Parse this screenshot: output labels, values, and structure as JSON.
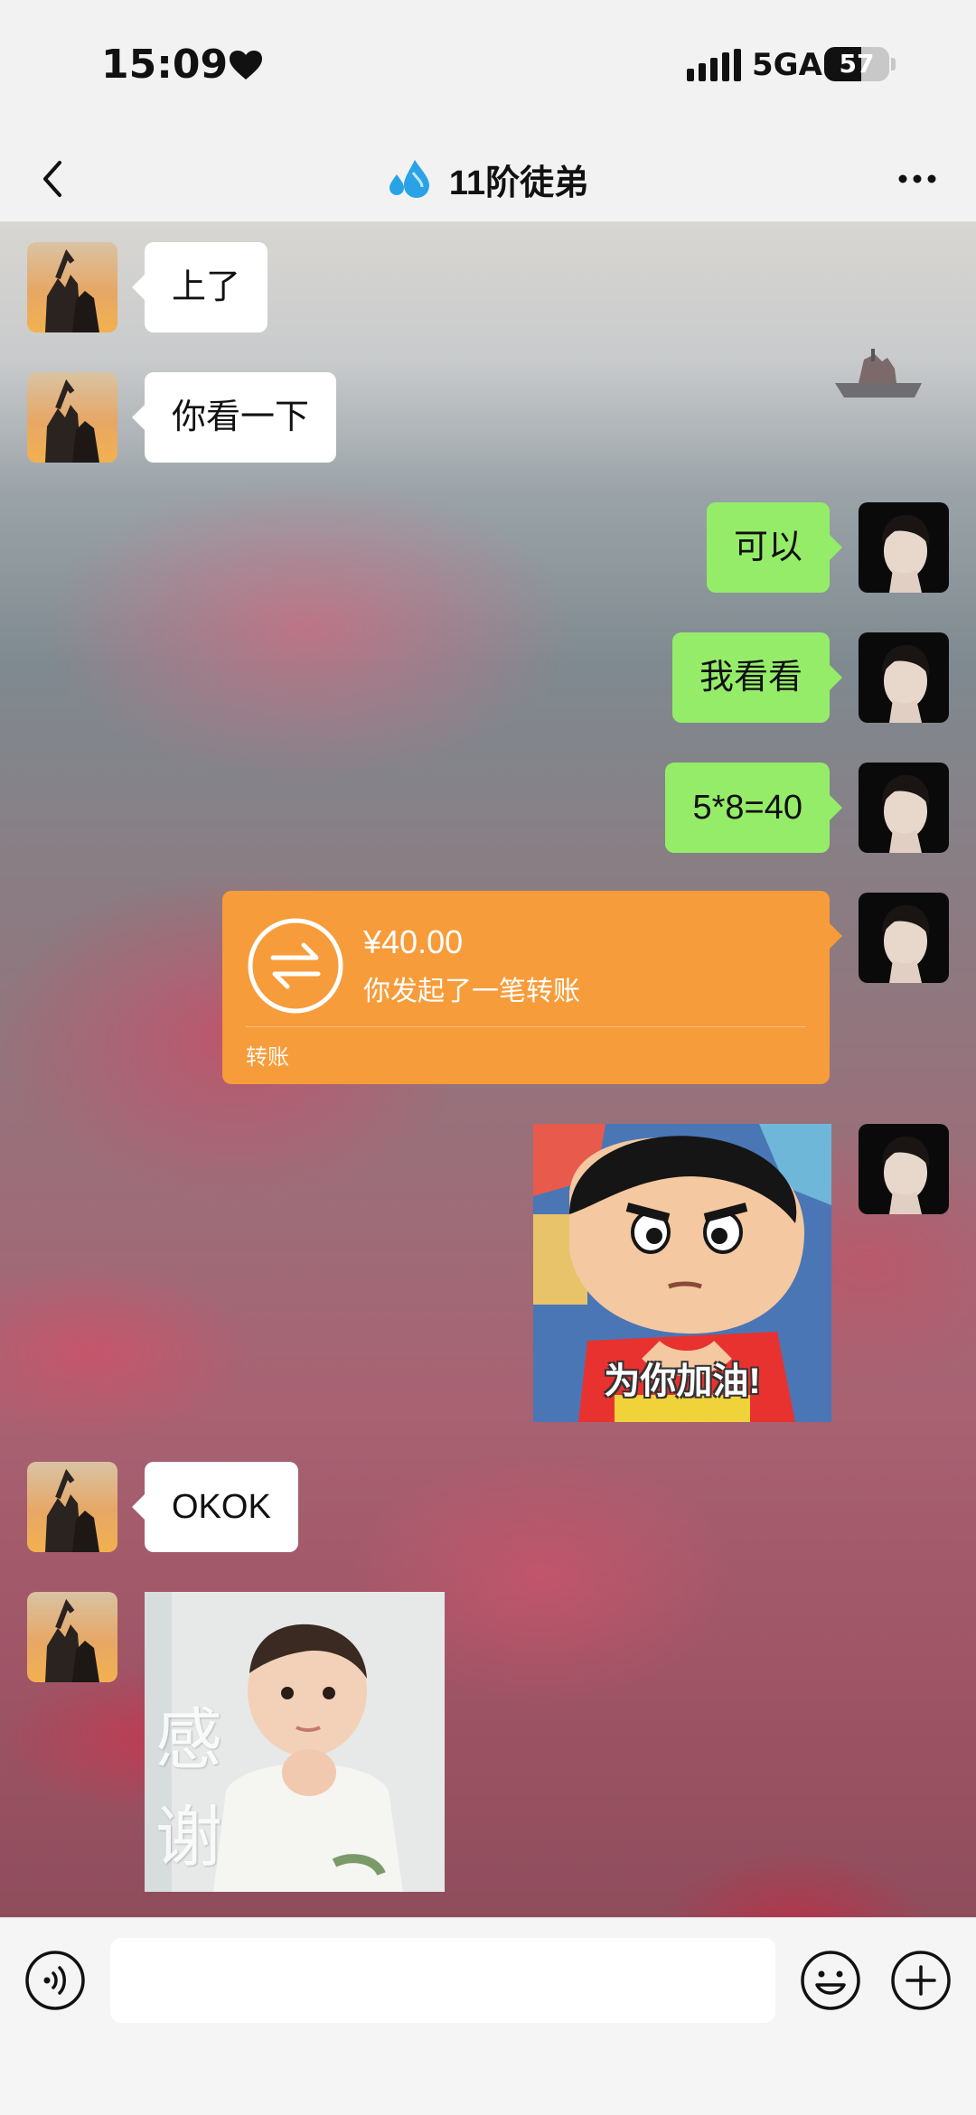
{
  "status_bar": {
    "time": "15:09",
    "network": "5GA",
    "battery": "57",
    "battery_level": 0.57
  },
  "header": {
    "title": "11阶徒弟",
    "title_icon": "sweat-droplets-icon",
    "back_icon": "chevron-left-icon",
    "more_icon": "more-dots-icon"
  },
  "messages": [
    {
      "side": "left",
      "type": "text",
      "text": "上了"
    },
    {
      "side": "left",
      "type": "text",
      "text": "你看一下"
    },
    {
      "side": "right",
      "type": "text",
      "text": "可以"
    },
    {
      "side": "right",
      "type": "text",
      "text": "我看看"
    },
    {
      "side": "right",
      "type": "text",
      "text": "5*8=40"
    },
    {
      "side": "right",
      "type": "transfer",
      "amount": "¥40.00",
      "description": "你发起了一笔转账",
      "label": "转账"
    },
    {
      "side": "right",
      "type": "sticker",
      "caption": "为你加油!"
    },
    {
      "side": "left",
      "type": "text",
      "text": "OKOK"
    },
    {
      "side": "left",
      "type": "sticker",
      "caption_line1": "感",
      "caption_line2": "谢"
    }
  ],
  "input_bar": {
    "voice_icon": "voice-icon",
    "emoji_icon": "emoji-icon",
    "plus_icon": "plus-icon",
    "input_value": ""
  },
  "colors": {
    "self_bubble": "#95ec69",
    "other_bubble": "#ffffff",
    "transfer_card": "#f79c3a",
    "bar_background": "#f2f2f2"
  }
}
